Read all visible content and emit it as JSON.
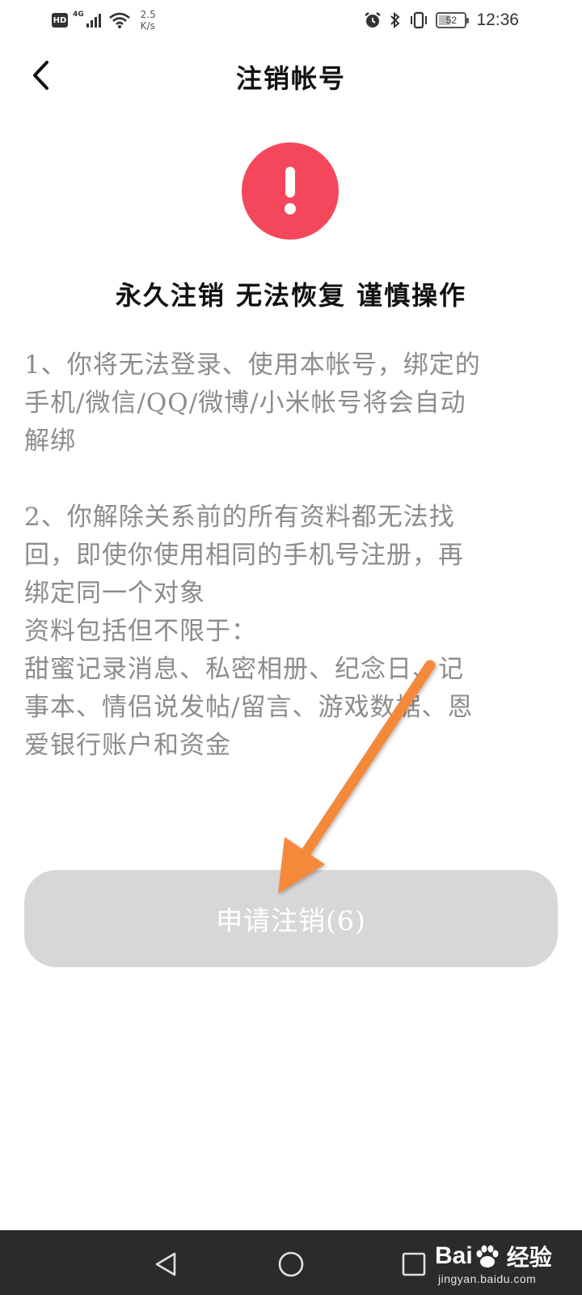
{
  "status_bar": {
    "hd": "HD",
    "network": "4G",
    "speed_value": "2.5",
    "speed_unit": "K/s",
    "battery": "52",
    "time": "12:36"
  },
  "header": {
    "title": "注销帐号"
  },
  "warning": {
    "heading": "永久注销 无法恢复 谨慎操作"
  },
  "description": {
    "lines": [
      "1、你将无法登录、使用本帐号，绑定的",
      "手机/微信/QQ/微博/小米帐号将会自动",
      "解绑",
      "",
      "2、你解除关系前的所有资料都无法找",
      "回，即使你使用相同的手机号注册，再",
      "绑定同一个对象",
      "资料包括但不限于：",
      "甜蜜记录消息、私密相册、纪念日、记",
      "事本、情侣说发帖/留言、游戏数据、恩",
      "爱银行账户和资金"
    ]
  },
  "apply_button": {
    "label": "申请注销(6)"
  },
  "watermark": {
    "brand_left": "Bai",
    "brand_right": "经验",
    "url": "jingyan.baidu.com"
  },
  "colors": {
    "warning_red": "#f5475c",
    "button_disabled": "#d7d7d9",
    "arrow_orange": "#f5893a",
    "nav_bar": "#2b2b2b"
  }
}
